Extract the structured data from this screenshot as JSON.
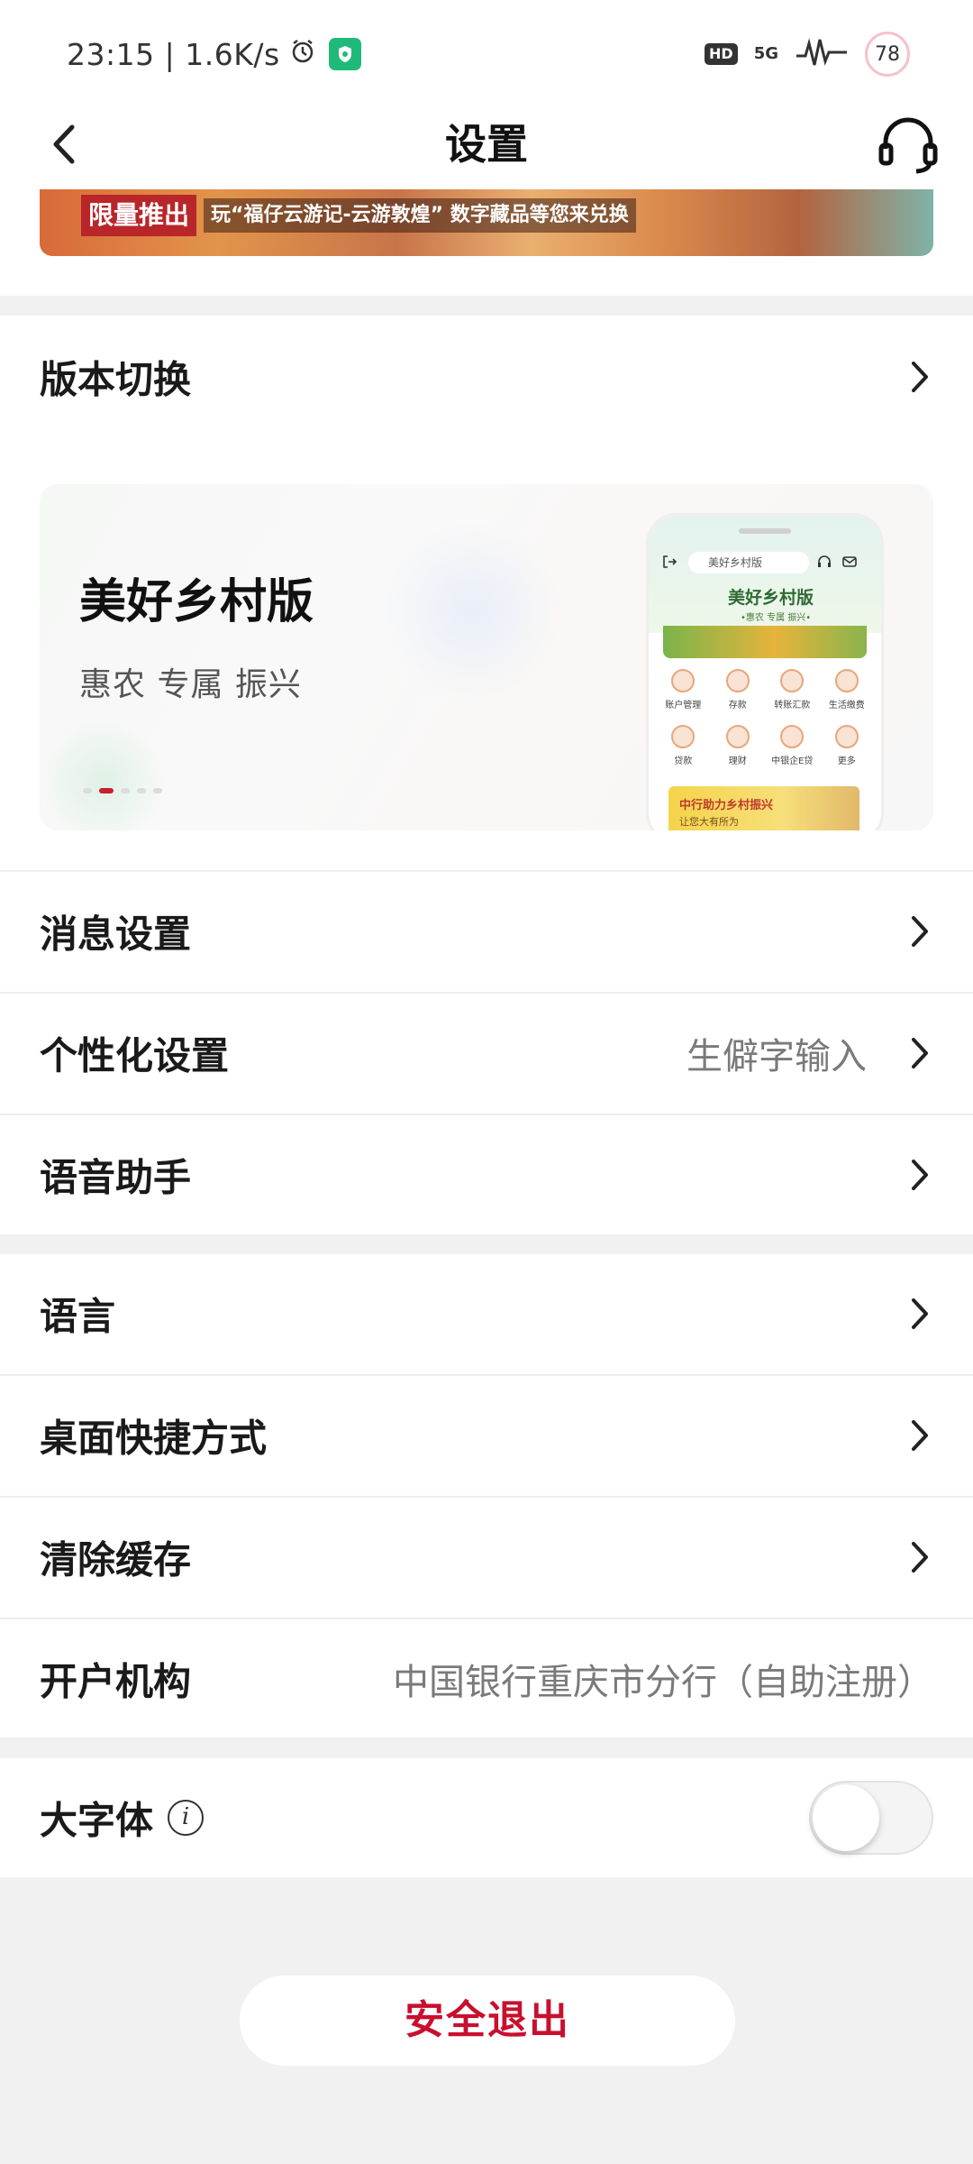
{
  "status_bar": {
    "time": "23:15",
    "net_speed": "1.6K/s",
    "hd": "HD",
    "network": "5G",
    "battery": "78"
  },
  "nav": {
    "title": "设置"
  },
  "banner": {
    "tag": "限量推出",
    "text": "玩“福仔云游记-云游敦煌” 数字藏品等您来兑换"
  },
  "version": {
    "label": "版本切换",
    "card_title": "美好乡村版",
    "card_subtitle": "惠农 专属 振兴",
    "active_slide": 2,
    "slide_count": 5,
    "phone": {
      "search": "美好乡村版",
      "heading": "美好乡村版",
      "slogan": "•惠农 专属 振兴•",
      "grid": [
        "账户管理",
        "存款",
        "转账汇款",
        "生活缴费",
        "贷款",
        "理财",
        "中银企E贷",
        "更多"
      ],
      "promo_line1": "中行助力乡村振兴",
      "promo_line2": "让您大有所为"
    }
  },
  "settings": {
    "messages": "消息设置",
    "personalization": "个性化设置",
    "personalization_value": "生僻字输入",
    "voice_assistant": "语音助手",
    "language": "语言",
    "desktop_shortcut": "桌面快捷方式",
    "clear_cache": "清除缓存",
    "branch": "开户机构",
    "branch_value": "中国银行重庆市分行（自助注册）",
    "large_font": "大字体",
    "large_font_info": "i",
    "large_font_enabled": false
  },
  "logout": {
    "label": "安全退出"
  },
  "colors": {
    "brand_red": "#c8102e",
    "background": "#f1f1f1"
  }
}
